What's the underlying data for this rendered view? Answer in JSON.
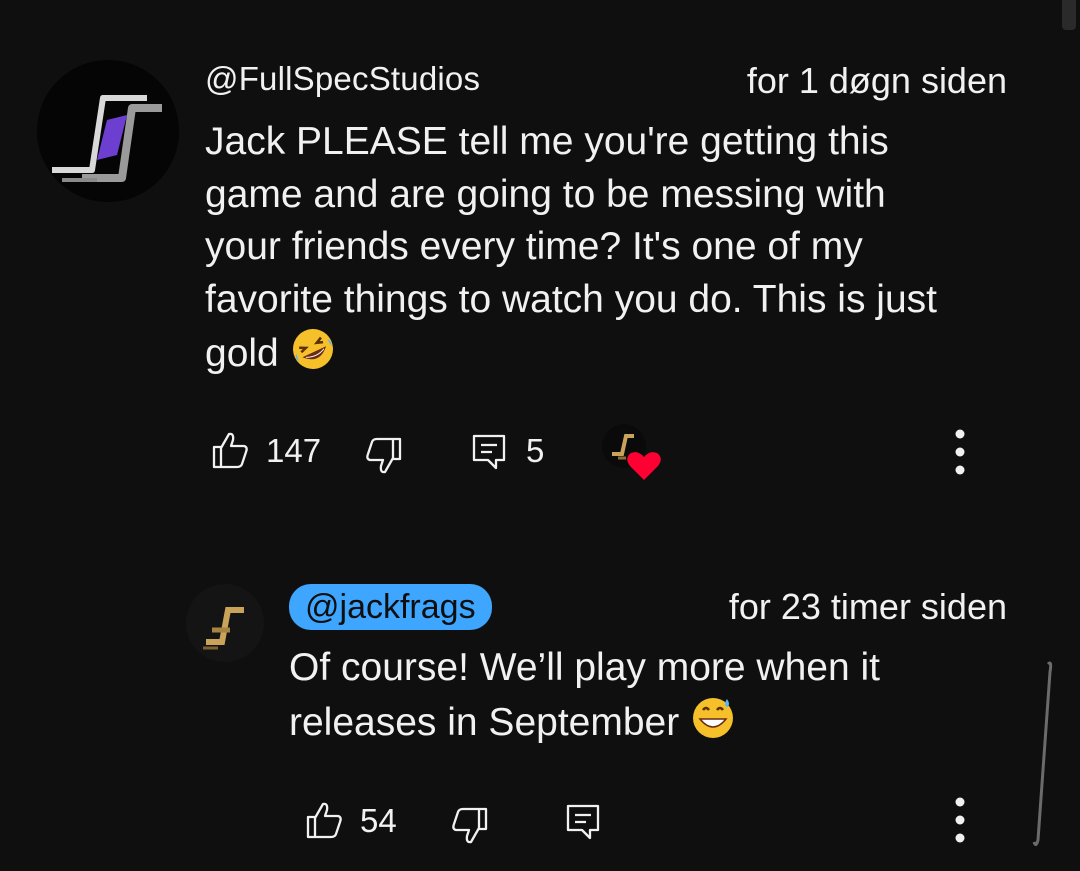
{
  "comments": [
    {
      "author": "@FullSpecStudios",
      "time": "for 1 døgn siden",
      "lines": [
        "Jack PLEASE tell me you're getting this",
        "game and are going to be messing with",
        "your friends every time? It's one of my",
        "favorite things to watch you do. This is just",
        "gold"
      ],
      "trailing_emoji": "rolling-on-floor-laughing-emoji",
      "likes": "147",
      "replies": "5",
      "creator_heart": true
    },
    {
      "author": "@jackfrags",
      "author_is_creator": true,
      "time": "for 23 timer siden",
      "lines": [
        "Of course! We’ll play more when it",
        "releases in September"
      ],
      "trailing_emoji": "grinning-sweat-emoji",
      "likes": "54"
    }
  ],
  "icons": {
    "like": "thumbs-up-icon",
    "dislike": "thumbs-down-icon",
    "reply": "reply-icon",
    "more": "more-vertical-icon",
    "heart": "heart-icon"
  },
  "colors": {
    "background": "#0f0f0f",
    "text": "#f1f1f1",
    "creator_pill": "#3ea6ff",
    "heart": "#ff0033"
  }
}
